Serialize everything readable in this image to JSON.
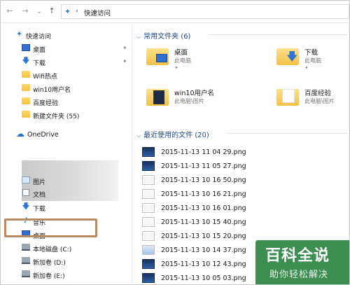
{
  "address": {
    "back_icon": "←",
    "forward_icon": "→",
    "dropdown_icon": "⌄",
    "up_icon": "↑",
    "pin_icon": "📌",
    "separator": "›",
    "path": "快速访问"
  },
  "sidebar": {
    "quick_access": "快速访问",
    "items": [
      {
        "label": "桌面",
        "icon": "desktop-icon",
        "pinned": true
      },
      {
        "label": "下载",
        "icon": "download-icon",
        "pinned": true
      },
      {
        "label": "Wifi热点",
        "icon": "folder-icon"
      },
      {
        "label": "win10用户名",
        "icon": "folder-icon"
      },
      {
        "label": "百度经验",
        "icon": "folder-icon"
      },
      {
        "label": "新建文件夹 (55)",
        "icon": "folder-icon"
      }
    ],
    "onedrive": "OneDrive",
    "pc_items": [
      {
        "label": "图片",
        "icon": "pictures-icon"
      },
      {
        "label": "文档",
        "icon": "documents-icon"
      },
      {
        "label": "下载",
        "icon": "download-icon"
      },
      {
        "label": "音乐",
        "icon": "music-icon"
      },
      {
        "label": "桌面",
        "icon": "desktop-icon"
      },
      {
        "label": "本地磁盘 (C:)",
        "icon": "disk-icon"
      },
      {
        "label": "新加卷 (D:)",
        "icon": "disk-icon"
      },
      {
        "label": "新加卷 (E:)",
        "icon": "disk-icon"
      }
    ],
    "pin_glyph": "✦"
  },
  "main": {
    "frequent": {
      "title": "常用文件夹 (6)",
      "tiles": [
        {
          "name": "桌面",
          "sub": "此电脑"
        },
        {
          "name": "下载",
          "sub": "此电脑"
        },
        {
          "name": "win10用户名",
          "sub": "此电脑\\图片"
        },
        {
          "name": "百度经验",
          "sub": "此电脑\\图片"
        }
      ]
    },
    "recent": {
      "title": "最近使用的文件 (20)",
      "files": [
        {
          "name": "2015-11-13 11 04 29.png",
          "thumb": "dark"
        },
        {
          "name": "2015-11-13 11 05 27.png",
          "thumb": "dark"
        },
        {
          "name": "2015-11-13 10 16 50.png",
          "thumb": "light"
        },
        {
          "name": "2015-11-13 10 16 21.png",
          "thumb": "light"
        },
        {
          "name": "2015-11-13 10 16 01.png",
          "thumb": "light"
        },
        {
          "name": "2015-11-13 10 15 40.png",
          "thumb": "light"
        },
        {
          "name": "2015-11-13 10 15 20.png",
          "thumb": "light"
        },
        {
          "name": "2015-11-13 10 14 37.png",
          "thumb": "blue"
        },
        {
          "name": "2015-11-13 10 12 43.png",
          "thumb": "dark"
        },
        {
          "name": "2015-11-13 10 05 03.png",
          "thumb": "dark"
        }
      ]
    }
  },
  "watermark": {
    "title": "百科全说",
    "subtitle": "助你轻松解决"
  },
  "colors": {
    "accent": "#1e4b8f",
    "highlight": "#b98a62",
    "watermark": "#2c8442"
  }
}
